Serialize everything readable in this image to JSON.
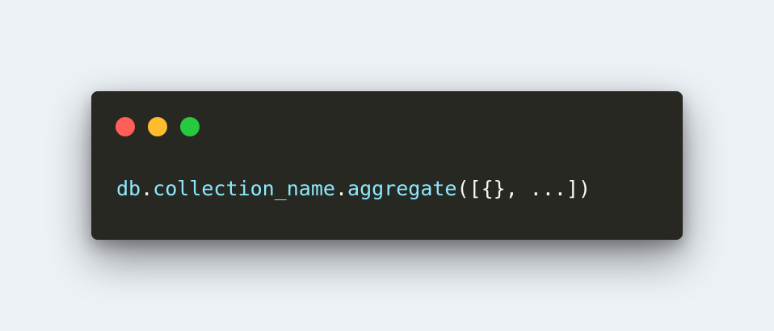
{
  "window": {
    "controls": [
      {
        "name": "close",
        "color": "#ff5f56"
      },
      {
        "name": "minimize",
        "color": "#ffbd2e"
      },
      {
        "name": "zoom",
        "color": "#27c93f"
      }
    ]
  },
  "code": {
    "tokens": [
      {
        "text": "db",
        "kind": "ident"
      },
      {
        "text": ".",
        "kind": "punct"
      },
      {
        "text": "collection_name",
        "kind": "ident"
      },
      {
        "text": ".",
        "kind": "punct"
      },
      {
        "text": "aggregate",
        "kind": "ident"
      },
      {
        "text": "([{}, ...])",
        "kind": "punct"
      }
    ]
  },
  "colors": {
    "background": "#edf2f7",
    "window": "#282823",
    "identifier": "#8be9fd",
    "punctuation": "#f8f8f2"
  }
}
